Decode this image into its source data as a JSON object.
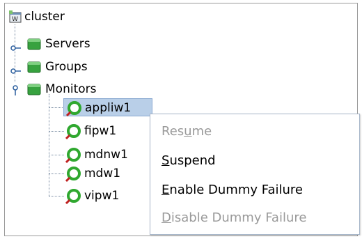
{
  "tree": {
    "root": {
      "label": "cluster",
      "icon": "cluster-icon"
    },
    "nodes": [
      {
        "label": "Servers",
        "icon": "folder-icon",
        "expanded": false
      },
      {
        "label": "Groups",
        "icon": "folder-icon",
        "expanded": false
      },
      {
        "label": "Monitors",
        "icon": "folder-icon",
        "expanded": true
      }
    ],
    "monitors": [
      {
        "label": "appliw1",
        "icon": "monitor-status-icon",
        "selected": true
      },
      {
        "label": "fipw1",
        "icon": "monitor-status-icon",
        "selected": false
      },
      {
        "label": "mdnw1",
        "icon": "monitor-status-icon",
        "selected": false
      },
      {
        "label": "mdw1",
        "icon": "monitor-status-icon",
        "selected": false
      },
      {
        "label": "vipw1",
        "icon": "monitor-status-icon",
        "selected": false
      }
    ]
  },
  "context_menu": {
    "items": [
      {
        "pre": "Res",
        "mnemonic": "u",
        "post": "me",
        "enabled": false
      },
      {
        "pre": "",
        "mnemonic": "S",
        "post": "uspend",
        "enabled": true
      },
      {
        "pre": "",
        "mnemonic": "E",
        "post": "nable Dummy Failure",
        "enabled": true
      },
      {
        "pre": "",
        "mnemonic": "D",
        "post": "isable Dummy Failure",
        "enabled": false
      }
    ]
  },
  "colors": {
    "selection": "#b9cfe8",
    "folder": "#2f9e3a",
    "monitor_ring": "#2fa82f",
    "disabled_text": "#9a9a9a"
  }
}
